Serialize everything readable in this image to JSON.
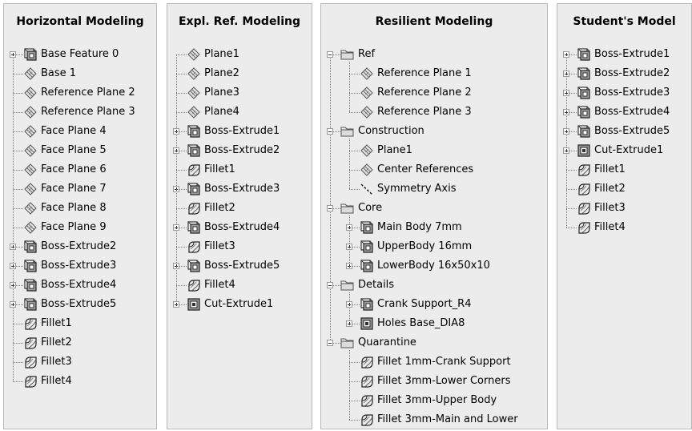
{
  "panels": [
    {
      "title": "Horizontal Modeling",
      "items": [
        {
          "label": "Base Feature 0",
          "icon": "boss-extrude-icon",
          "level": 0,
          "expander": "plus"
        },
        {
          "label": "Base 1",
          "icon": "plane-icon",
          "level": 0,
          "expander": ""
        },
        {
          "label": "Reference Plane 2",
          "icon": "plane-icon",
          "level": 0,
          "expander": ""
        },
        {
          "label": "Reference Plane 3",
          "icon": "plane-icon",
          "level": 0,
          "expander": ""
        },
        {
          "label": "Face Plane 4",
          "icon": "plane-icon",
          "level": 0,
          "expander": ""
        },
        {
          "label": "Face Plane 5",
          "icon": "plane-icon",
          "level": 0,
          "expander": ""
        },
        {
          "label": "Face Plane 6",
          "icon": "plane-icon",
          "level": 0,
          "expander": ""
        },
        {
          "label": "Face Plane 7",
          "icon": "plane-icon",
          "level": 0,
          "expander": ""
        },
        {
          "label": "Face Plane 8",
          "icon": "plane-icon",
          "level": 0,
          "expander": ""
        },
        {
          "label": "Face Plane 9",
          "icon": "plane-icon",
          "level": 0,
          "expander": ""
        },
        {
          "label": "Boss-Extrude2",
          "icon": "boss-extrude-icon",
          "level": 0,
          "expander": "plus"
        },
        {
          "label": "Boss-Extrude3",
          "icon": "boss-extrude-icon",
          "level": 0,
          "expander": "plus"
        },
        {
          "label": "Boss-Extrude4",
          "icon": "boss-extrude-icon",
          "level": 0,
          "expander": "plus"
        },
        {
          "label": "Boss-Extrude5",
          "icon": "boss-extrude-icon",
          "level": 0,
          "expander": "plus"
        },
        {
          "label": "Fillet1",
          "icon": "fillet-icon",
          "level": 0,
          "expander": ""
        },
        {
          "label": "Fillet2",
          "icon": "fillet-icon",
          "level": 0,
          "expander": ""
        },
        {
          "label": "Fillet3",
          "icon": "fillet-icon",
          "level": 0,
          "expander": ""
        },
        {
          "label": "Fillet4",
          "icon": "fillet-icon",
          "level": 0,
          "expander": ""
        }
      ]
    },
    {
      "title": "Expl. Ref. Modeling",
      "items": [
        {
          "label": "Plane1",
          "icon": "plane-icon",
          "level": 0,
          "expander": ""
        },
        {
          "label": "Plane2",
          "icon": "plane-icon",
          "level": 0,
          "expander": ""
        },
        {
          "label": "Plane3",
          "icon": "plane-icon",
          "level": 0,
          "expander": ""
        },
        {
          "label": "Plane4",
          "icon": "plane-icon",
          "level": 0,
          "expander": ""
        },
        {
          "label": "Boss-Extrude1",
          "icon": "boss-extrude-icon",
          "level": 0,
          "expander": "plus"
        },
        {
          "label": "Boss-Extrude2",
          "icon": "boss-extrude-icon",
          "level": 0,
          "expander": "plus"
        },
        {
          "label": "Fillet1",
          "icon": "fillet-icon",
          "level": 0,
          "expander": ""
        },
        {
          "label": "Boss-Extrude3",
          "icon": "boss-extrude-icon",
          "level": 0,
          "expander": "plus"
        },
        {
          "label": "Fillet2",
          "icon": "fillet-icon",
          "level": 0,
          "expander": ""
        },
        {
          "label": "Boss-Extrude4",
          "icon": "boss-extrude-icon",
          "level": 0,
          "expander": "plus"
        },
        {
          "label": "Fillet3",
          "icon": "fillet-icon",
          "level": 0,
          "expander": ""
        },
        {
          "label": "Boss-Extrude5",
          "icon": "boss-extrude-icon",
          "level": 0,
          "expander": "plus"
        },
        {
          "label": "Fillet4",
          "icon": "fillet-icon",
          "level": 0,
          "expander": ""
        },
        {
          "label": "Cut-Extrude1",
          "icon": "cut-extrude-icon",
          "level": 0,
          "expander": "plus"
        }
      ]
    },
    {
      "title": "Resilient Modeling",
      "items": [
        {
          "label": "Ref",
          "icon": "folder-icon",
          "level": 0,
          "expander": "minus"
        },
        {
          "label": "Reference Plane 1",
          "icon": "plane-icon",
          "level": 1,
          "expander": ""
        },
        {
          "label": "Reference Plane 2",
          "icon": "plane-icon",
          "level": 1,
          "expander": ""
        },
        {
          "label": "Reference Plane 3",
          "icon": "plane-icon",
          "level": 1,
          "expander": ""
        },
        {
          "label": "Construction",
          "icon": "folder-icon",
          "level": 0,
          "expander": "minus"
        },
        {
          "label": "Plane1",
          "icon": "plane-icon",
          "level": 1,
          "expander": ""
        },
        {
          "label": "Center References",
          "icon": "plane-icon",
          "level": 1,
          "expander": ""
        },
        {
          "label": "Symmetry Axis",
          "icon": "axis-icon",
          "level": 1,
          "expander": ""
        },
        {
          "label": "Core",
          "icon": "folder-icon",
          "level": 0,
          "expander": "minus"
        },
        {
          "label": "Main Body 7mm",
          "icon": "boss-extrude-icon",
          "level": 1,
          "expander": "plus"
        },
        {
          "label": "UpperBody 16mm",
          "icon": "boss-extrude-icon",
          "level": 1,
          "expander": "plus"
        },
        {
          "label": "LowerBody 16x50x10",
          "icon": "boss-extrude-icon",
          "level": 1,
          "expander": "plus"
        },
        {
          "label": "Details",
          "icon": "folder-icon",
          "level": 0,
          "expander": "minus"
        },
        {
          "label": "Crank Support_R4",
          "icon": "boss-extrude-icon",
          "level": 1,
          "expander": "plus"
        },
        {
          "label": "Holes Base_DIA8",
          "icon": "cut-extrude-icon",
          "level": 1,
          "expander": "plus"
        },
        {
          "label": "Quarantine",
          "icon": "folder-icon",
          "level": 0,
          "expander": "minus"
        },
        {
          "label": "Fillet 1mm-Crank Support",
          "icon": "fillet-icon",
          "level": 1,
          "expander": ""
        },
        {
          "label": "Fillet 3mm-Lower Corners",
          "icon": "fillet-icon",
          "level": 1,
          "expander": ""
        },
        {
          "label": "Fillet 3mm-Upper Body",
          "icon": "fillet-icon",
          "level": 1,
          "expander": ""
        },
        {
          "label": "Fillet 3mm-Main and Lower",
          "icon": "fillet-icon",
          "level": 1,
          "expander": ""
        }
      ]
    },
    {
      "title": "Student's Model",
      "items": [
        {
          "label": "Boss-Extrude1",
          "icon": "boss-extrude-icon",
          "level": 0,
          "expander": "plus"
        },
        {
          "label": "Boss-Extrude2",
          "icon": "boss-extrude-icon",
          "level": 0,
          "expander": "plus"
        },
        {
          "label": "Boss-Extrude3",
          "icon": "boss-extrude-icon",
          "level": 0,
          "expander": "plus"
        },
        {
          "label": "Boss-Extrude4",
          "icon": "boss-extrude-icon",
          "level": 0,
          "expander": "plus"
        },
        {
          "label": "Boss-Extrude5",
          "icon": "boss-extrude-icon",
          "level": 0,
          "expander": "plus"
        },
        {
          "label": "Cut-Extrude1",
          "icon": "cut-extrude-icon",
          "level": 0,
          "expander": "plus"
        },
        {
          "label": "Fillet1",
          "icon": "fillet-icon",
          "level": 0,
          "expander": ""
        },
        {
          "label": "Fillet2",
          "icon": "fillet-icon",
          "level": 0,
          "expander": ""
        },
        {
          "label": "Fillet3",
          "icon": "fillet-icon",
          "level": 0,
          "expander": ""
        },
        {
          "label": "Fillet4",
          "icon": "fillet-icon",
          "level": 0,
          "expander": ""
        }
      ]
    }
  ]
}
